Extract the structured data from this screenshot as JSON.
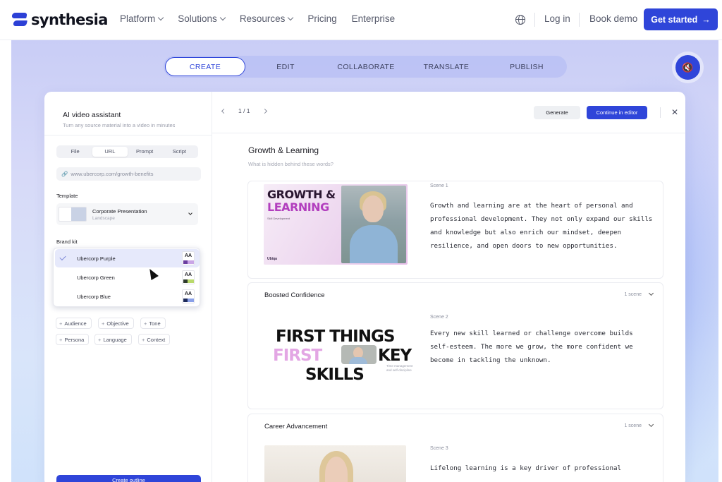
{
  "nav": {
    "logo": "synthesia",
    "menu": [
      {
        "label": "Platform",
        "dropdown": true
      },
      {
        "label": "Solutions",
        "dropdown": true
      },
      {
        "label": "Resources",
        "dropdown": true
      },
      {
        "label": "Pricing",
        "dropdown": false
      },
      {
        "label": "Enterprise",
        "dropdown": false
      }
    ],
    "login": "Log in",
    "demo": "Book demo",
    "cta": "Get started",
    "cta_arrow": "→"
  },
  "tabs": [
    "CREATE",
    "EDIT",
    "COLLABORATE",
    "TRANSLATE",
    "PUBLISH"
  ],
  "mute_icon": "🔇",
  "sidebar": {
    "title": "AI video assistant",
    "subtitle": "Turn any source material into a video in minutes",
    "source_tabs": [
      "File",
      "URL",
      "Prompt",
      "Script"
    ],
    "url_value": "www.ubercorp.com/growth-benefits",
    "template_label": "Template",
    "template_name": "Corporate Presentation",
    "template_sub": "Landscape",
    "brand_label": "Brand kit",
    "brands": [
      {
        "name": "Ubercorp Purple",
        "swatch": "AA",
        "c1": "#6b3fa0",
        "c2": "#c9a5e6"
      },
      {
        "name": "Ubercorp Green",
        "swatch": "AA",
        "c1": "#2f3a2e",
        "c2": "#b9d96b"
      },
      {
        "name": "Ubercorp Blue",
        "swatch": "AA",
        "c1": "#1d2a5a",
        "c2": "#8aa0e8"
      }
    ],
    "chips": [
      "Audience",
      "Objective",
      "Tone",
      "Persona",
      "Language",
      "Context"
    ],
    "outline_button": "Create outline"
  },
  "editor": {
    "pager": "1 / 1",
    "generate": "Generate",
    "continue": "Continue in editor",
    "close": "✕",
    "doc_title": "Growth & Learning",
    "doc_sub": "What is hidden behind these words?"
  },
  "scenes": [
    {
      "heading": "",
      "label": "Scene 1",
      "text": "Growth and learning are at the heart of personal and professional development. They not only expand our skills and knowledge but also enrich our mindset, deepen resilience, and open doors to new opportunities.",
      "thumb_line1": "GROWTH &",
      "thumb_line2": "LEARNING",
      "thumb_small": "Skill Development",
      "thumb_logo": "Ubiqa"
    },
    {
      "heading": "Boosted Confidence",
      "count": "1 scene",
      "label": "Scene 2",
      "text": "Every new skill learned or challenge overcome builds self-esteem. The more we grow, the more confident we become in tackling the unknown.",
      "thumb_line1": "FIRST THINGS",
      "thumb_line2a": "FIRST",
      "thumb_line2b": "KEY",
      "thumb_line3": "SKILLS",
      "thumb_caption": "Time management and self-discipline"
    },
    {
      "heading": "Career Advancement",
      "count": "1 scene",
      "label": "Scene 3",
      "text": "Lifelong learning is a key driver of professional"
    }
  ]
}
